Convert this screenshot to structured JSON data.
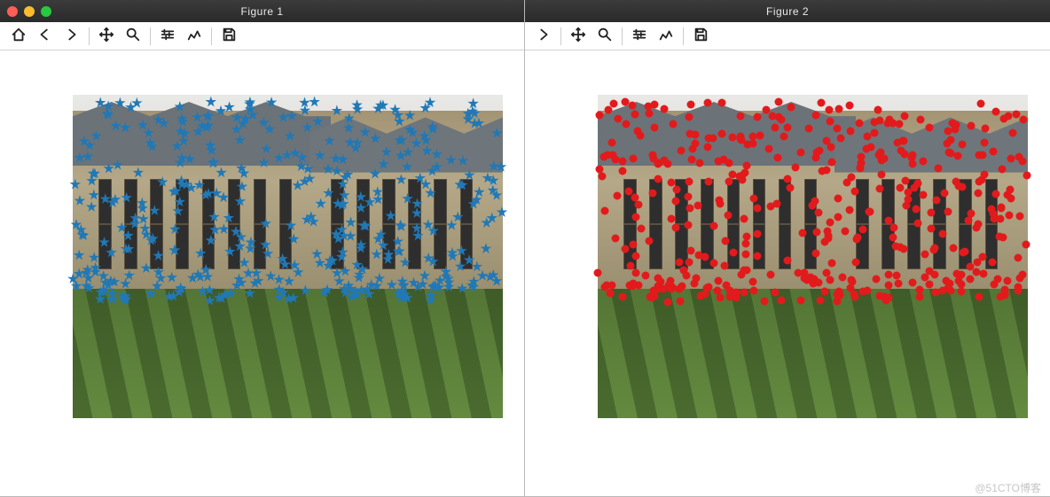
{
  "windows": [
    {
      "title": "Figure 1",
      "has_traffic_lights": true,
      "has_home_back": true,
      "marker_type": "star",
      "marker_color": "#2178b5"
    },
    {
      "title": "Figure 2",
      "has_traffic_lights": false,
      "has_home_back": false,
      "marker_type": "dot",
      "marker_color": "#e31a1c"
    }
  ],
  "toolbar": {
    "home": "Home",
    "back": "Back",
    "forward": "Forward",
    "pan": "Pan",
    "zoom": "Zoom",
    "config": "Configure",
    "edit": "Edit",
    "save": "Save"
  },
  "watermark": "@51CTO博客"
}
